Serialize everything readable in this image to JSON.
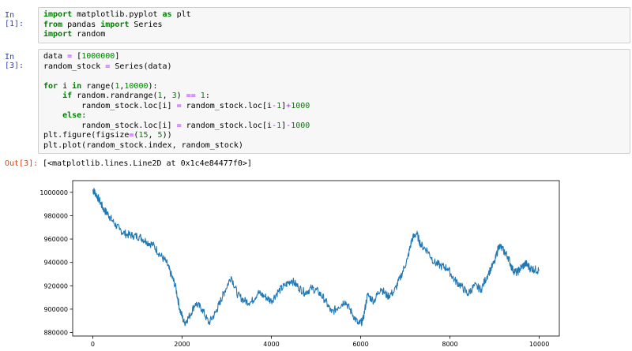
{
  "cell1": {
    "prompt": "In [1]:",
    "lines": [
      [
        [
          "kw",
          "import"
        ],
        [
          "t",
          " matplotlib.pyplot "
        ],
        [
          "kw",
          "as"
        ],
        [
          "t",
          " plt"
        ]
      ],
      [
        [
          "kw",
          "from"
        ],
        [
          "t",
          " pandas "
        ],
        [
          "kw",
          "import"
        ],
        [
          "t",
          " Series"
        ]
      ],
      [
        [
          "kw",
          "import"
        ],
        [
          "t",
          " random"
        ]
      ]
    ]
  },
  "cell2": {
    "prompt": "In [3]:",
    "lines": [
      [
        [
          "t",
          "data "
        ],
        [
          "op",
          "="
        ],
        [
          "t",
          " ["
        ],
        [
          "num",
          "1000000"
        ],
        [
          "t",
          "]"
        ]
      ],
      [
        [
          "t",
          "random_stock "
        ],
        [
          "op",
          "="
        ],
        [
          "t",
          " Series(data)"
        ]
      ],
      [
        [
          "t",
          ""
        ]
      ],
      [
        [
          "kw",
          "for"
        ],
        [
          "t",
          " i "
        ],
        [
          "kw",
          "in"
        ],
        [
          "t",
          " range("
        ],
        [
          "num",
          "1"
        ],
        [
          "t",
          ","
        ],
        [
          "num",
          "10000"
        ],
        [
          "t",
          "):"
        ]
      ],
      [
        [
          "t",
          "    "
        ],
        [
          "kw",
          "if"
        ],
        [
          "t",
          " random"
        ],
        [
          "t",
          "."
        ],
        [
          "t",
          "randrange("
        ],
        [
          "num",
          "1"
        ],
        [
          "t",
          ", "
        ],
        [
          "num",
          "3"
        ],
        [
          "t",
          ") "
        ],
        [
          "op",
          "=="
        ],
        [
          "t",
          " "
        ],
        [
          "num",
          "1"
        ],
        [
          "t",
          ":"
        ]
      ],
      [
        [
          "t",
          "        random_stock"
        ],
        [
          "t",
          "."
        ],
        [
          "t",
          "loc[i] "
        ],
        [
          "op",
          "="
        ],
        [
          "t",
          " random_stock"
        ],
        [
          "t",
          "."
        ],
        [
          "t",
          "loc[i"
        ],
        [
          "op",
          "-"
        ],
        [
          "num",
          "1"
        ],
        [
          "t",
          "]"
        ],
        [
          "op",
          "+"
        ],
        [
          "num",
          "1000"
        ]
      ],
      [
        [
          "t",
          "    "
        ],
        [
          "kw",
          "else"
        ],
        [
          "t",
          ":"
        ]
      ],
      [
        [
          "t",
          "        random_stock"
        ],
        [
          "t",
          "."
        ],
        [
          "t",
          "loc[i] "
        ],
        [
          "op",
          "="
        ],
        [
          "t",
          " random_stock"
        ],
        [
          "t",
          "."
        ],
        [
          "t",
          "loc[i"
        ],
        [
          "op",
          "-"
        ],
        [
          "num",
          "1"
        ],
        [
          "t",
          "]"
        ],
        [
          "op",
          "-"
        ],
        [
          "num",
          "1000"
        ]
      ],
      [
        [
          "t",
          "plt"
        ],
        [
          "t",
          "."
        ],
        [
          "t",
          "figure(figsize"
        ],
        [
          "op",
          "="
        ],
        [
          "t",
          "("
        ],
        [
          "num",
          "15"
        ],
        [
          "t",
          ", "
        ],
        [
          "num",
          "5"
        ],
        [
          "t",
          "))"
        ]
      ],
      [
        [
          "t",
          "plt"
        ],
        [
          "t",
          "."
        ],
        [
          "t",
          "plot(random_stock"
        ],
        [
          "t",
          "."
        ],
        [
          "t",
          "index, random_stock)"
        ]
      ]
    ]
  },
  "output": {
    "prompt": "Out[3]:",
    "text": "[<matplotlib.lines.Line2D at 0x1c4e84477f0>]"
  },
  "colors": {
    "line": "#1f77b4",
    "prompt_in": "#303f9f",
    "prompt_out": "#d84315"
  },
  "chart_data": {
    "type": "line",
    "title": "",
    "xlabel": "",
    "ylabel": "",
    "xlim": [
      -450,
      10450
    ],
    "ylim": [
      877000,
      1010000
    ],
    "xticks": [
      0,
      2000,
      4000,
      6000,
      8000,
      10000
    ],
    "yticks": [
      880000,
      900000,
      920000,
      940000,
      960000,
      980000,
      1000000
    ],
    "grid": false,
    "series": [
      {
        "x": [
          0,
          50,
          150,
          250,
          350,
          450,
          600,
          750,
          900,
          1050,
          1200,
          1350,
          1500,
          1650,
          1750,
          1850,
          1950,
          2050,
          2150,
          2300,
          2450,
          2600,
          2750,
          2850,
          2950,
          3100,
          3250,
          3400,
          3550,
          3700,
          3850,
          4000,
          4150,
          4300,
          4450,
          4600,
          4750,
          4900,
          5050,
          5200,
          5350,
          5500,
          5650,
          5800,
          5950,
          6050,
          6150,
          6300,
          6450,
          6600,
          6750,
          6900,
          7050,
          7150,
          7250,
          7350,
          7500,
          7650,
          7800,
          7950,
          8100,
          8250,
          8400,
          8550,
          8700,
          8850,
          9000,
          9100,
          9200,
          9300,
          9400,
          9500,
          9600,
          9700,
          9800,
          9900,
          10000
        ],
        "y": [
          1002000,
          1000000,
          993000,
          985000,
          981000,
          975000,
          968000,
          964000,
          963000,
          962000,
          958000,
          955000,
          947000,
          940000,
          930000,
          920000,
          900000,
          888000,
          893000,
          905000,
          900000,
          888000,
          897000,
          906000,
          915000,
          928000,
          912000,
          907000,
          906000,
          914000,
          911000,
          907000,
          915000,
          920000,
          925000,
          919000,
          914000,
          918000,
          915000,
          908000,
          897000,
          902000,
          907000,
          897000,
          887000,
          890000,
          912000,
          907000,
          918000,
          911000,
          915000,
          928000,
          943000,
          960000,
          965000,
          955000,
          950000,
          940000,
          937000,
          935000,
          925000,
          920000,
          913000,
          920000,
          917000,
          930000,
          940000,
          955000,
          950000,
          945000,
          934000,
          931000,
          936000,
          939000,
          935000,
          934000,
          933000
        ]
      }
    ]
  }
}
